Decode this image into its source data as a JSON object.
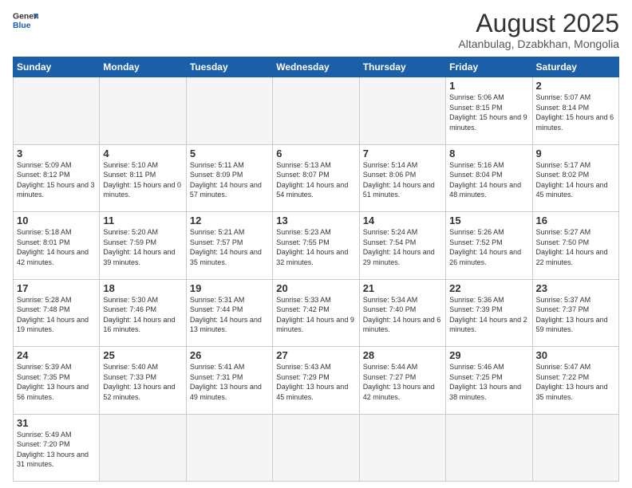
{
  "logo": {
    "text_general": "General",
    "text_blue": "Blue"
  },
  "header": {
    "title": "August 2025",
    "subtitle": "Altanbulag, Dzabkhan, Mongolia"
  },
  "weekdays": [
    "Sunday",
    "Monday",
    "Tuesday",
    "Wednesday",
    "Thursday",
    "Friday",
    "Saturday"
  ],
  "weeks": [
    [
      {
        "day": "",
        "info": ""
      },
      {
        "day": "",
        "info": ""
      },
      {
        "day": "",
        "info": ""
      },
      {
        "day": "",
        "info": ""
      },
      {
        "day": "",
        "info": ""
      },
      {
        "day": "1",
        "info": "Sunrise: 5:06 AM\nSunset: 8:15 PM\nDaylight: 15 hours and 9 minutes."
      },
      {
        "day": "2",
        "info": "Sunrise: 5:07 AM\nSunset: 8:14 PM\nDaylight: 15 hours and 6 minutes."
      }
    ],
    [
      {
        "day": "3",
        "info": "Sunrise: 5:09 AM\nSunset: 8:12 PM\nDaylight: 15 hours and 3 minutes."
      },
      {
        "day": "4",
        "info": "Sunrise: 5:10 AM\nSunset: 8:11 PM\nDaylight: 15 hours and 0 minutes."
      },
      {
        "day": "5",
        "info": "Sunrise: 5:11 AM\nSunset: 8:09 PM\nDaylight: 14 hours and 57 minutes."
      },
      {
        "day": "6",
        "info": "Sunrise: 5:13 AM\nSunset: 8:07 PM\nDaylight: 14 hours and 54 minutes."
      },
      {
        "day": "7",
        "info": "Sunrise: 5:14 AM\nSunset: 8:06 PM\nDaylight: 14 hours and 51 minutes."
      },
      {
        "day": "8",
        "info": "Sunrise: 5:16 AM\nSunset: 8:04 PM\nDaylight: 14 hours and 48 minutes."
      },
      {
        "day": "9",
        "info": "Sunrise: 5:17 AM\nSunset: 8:02 PM\nDaylight: 14 hours and 45 minutes."
      }
    ],
    [
      {
        "day": "10",
        "info": "Sunrise: 5:18 AM\nSunset: 8:01 PM\nDaylight: 14 hours and 42 minutes."
      },
      {
        "day": "11",
        "info": "Sunrise: 5:20 AM\nSunset: 7:59 PM\nDaylight: 14 hours and 39 minutes."
      },
      {
        "day": "12",
        "info": "Sunrise: 5:21 AM\nSunset: 7:57 PM\nDaylight: 14 hours and 35 minutes."
      },
      {
        "day": "13",
        "info": "Sunrise: 5:23 AM\nSunset: 7:55 PM\nDaylight: 14 hours and 32 minutes."
      },
      {
        "day": "14",
        "info": "Sunrise: 5:24 AM\nSunset: 7:54 PM\nDaylight: 14 hours and 29 minutes."
      },
      {
        "day": "15",
        "info": "Sunrise: 5:26 AM\nSunset: 7:52 PM\nDaylight: 14 hours and 26 minutes."
      },
      {
        "day": "16",
        "info": "Sunrise: 5:27 AM\nSunset: 7:50 PM\nDaylight: 14 hours and 22 minutes."
      }
    ],
    [
      {
        "day": "17",
        "info": "Sunrise: 5:28 AM\nSunset: 7:48 PM\nDaylight: 14 hours and 19 minutes."
      },
      {
        "day": "18",
        "info": "Sunrise: 5:30 AM\nSunset: 7:46 PM\nDaylight: 14 hours and 16 minutes."
      },
      {
        "day": "19",
        "info": "Sunrise: 5:31 AM\nSunset: 7:44 PM\nDaylight: 14 hours and 13 minutes."
      },
      {
        "day": "20",
        "info": "Sunrise: 5:33 AM\nSunset: 7:42 PM\nDaylight: 14 hours and 9 minutes."
      },
      {
        "day": "21",
        "info": "Sunrise: 5:34 AM\nSunset: 7:40 PM\nDaylight: 14 hours and 6 minutes."
      },
      {
        "day": "22",
        "info": "Sunrise: 5:36 AM\nSunset: 7:39 PM\nDaylight: 14 hours and 2 minutes."
      },
      {
        "day": "23",
        "info": "Sunrise: 5:37 AM\nSunset: 7:37 PM\nDaylight: 13 hours and 59 minutes."
      }
    ],
    [
      {
        "day": "24",
        "info": "Sunrise: 5:39 AM\nSunset: 7:35 PM\nDaylight: 13 hours and 56 minutes."
      },
      {
        "day": "25",
        "info": "Sunrise: 5:40 AM\nSunset: 7:33 PM\nDaylight: 13 hours and 52 minutes."
      },
      {
        "day": "26",
        "info": "Sunrise: 5:41 AM\nSunset: 7:31 PM\nDaylight: 13 hours and 49 minutes."
      },
      {
        "day": "27",
        "info": "Sunrise: 5:43 AM\nSunset: 7:29 PM\nDaylight: 13 hours and 45 minutes."
      },
      {
        "day": "28",
        "info": "Sunrise: 5:44 AM\nSunset: 7:27 PM\nDaylight: 13 hours and 42 minutes."
      },
      {
        "day": "29",
        "info": "Sunrise: 5:46 AM\nSunset: 7:25 PM\nDaylight: 13 hours and 38 minutes."
      },
      {
        "day": "30",
        "info": "Sunrise: 5:47 AM\nSunset: 7:22 PM\nDaylight: 13 hours and 35 minutes."
      }
    ],
    [
      {
        "day": "31",
        "info": "Sunrise: 5:49 AM\nSunset: 7:20 PM\nDaylight: 13 hours and 31 minutes."
      },
      {
        "day": "",
        "info": ""
      },
      {
        "day": "",
        "info": ""
      },
      {
        "day": "",
        "info": ""
      },
      {
        "day": "",
        "info": ""
      },
      {
        "day": "",
        "info": ""
      },
      {
        "day": "",
        "info": ""
      }
    ]
  ]
}
